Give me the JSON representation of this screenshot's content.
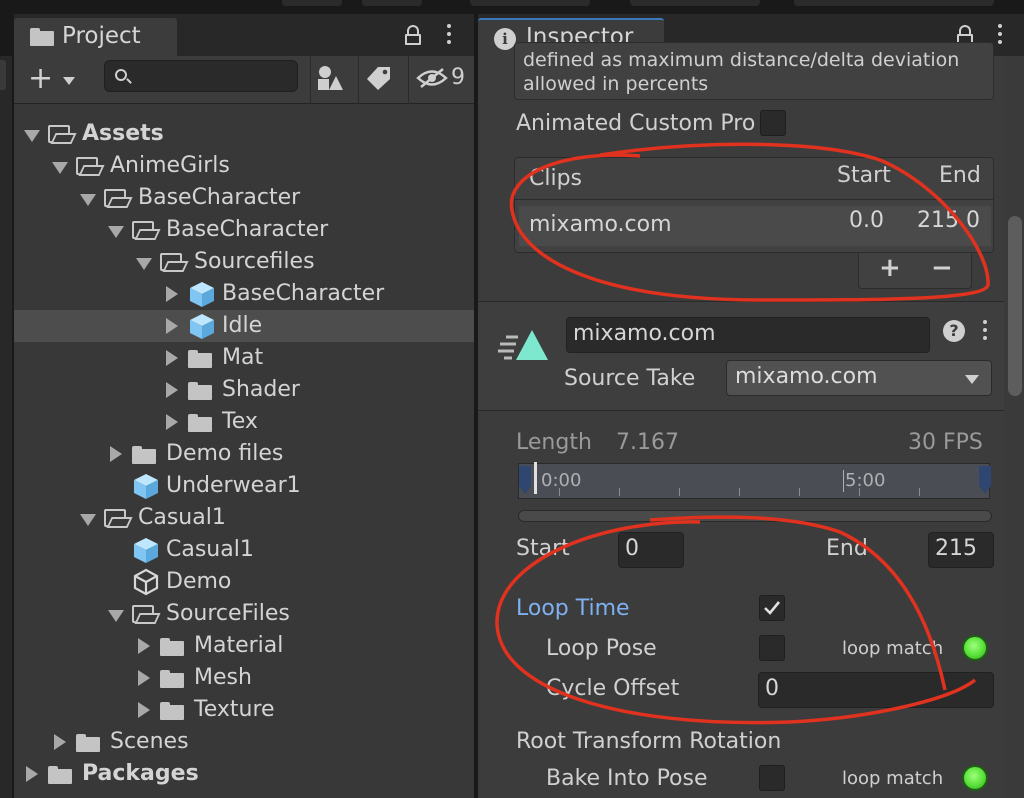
{
  "project": {
    "tab_label": "Project",
    "search": {
      "value": "",
      "placeholder": ""
    },
    "hidden_count": "9",
    "tree": [
      {
        "label": "Assets",
        "bold": true,
        "depth": 0,
        "expanded": true,
        "kind": "folder"
      },
      {
        "label": "AnimeGirls",
        "depth": 1,
        "expanded": true,
        "kind": "folder"
      },
      {
        "label": "BaseCharacter",
        "depth": 2,
        "expanded": true,
        "kind": "folder"
      },
      {
        "label": "BaseCharacter",
        "depth": 3,
        "expanded": true,
        "kind": "folder"
      },
      {
        "label": "Sourcefiles",
        "depth": 4,
        "expanded": true,
        "kind": "folder"
      },
      {
        "label": "BaseCharacter",
        "depth": 5,
        "expanded": false,
        "kind": "prefab"
      },
      {
        "label": "Idle",
        "depth": 5,
        "expanded": false,
        "kind": "prefab",
        "selected": true
      },
      {
        "label": "Mat",
        "depth": 5,
        "expanded": false,
        "kind": "folder"
      },
      {
        "label": "Shader",
        "depth": 5,
        "expanded": false,
        "kind": "folder"
      },
      {
        "label": "Tex",
        "depth": 5,
        "expanded": false,
        "kind": "folder"
      },
      {
        "label": "Demo files",
        "depth": 3,
        "expanded": false,
        "kind": "folder"
      },
      {
        "label": "Underwear1",
        "depth": 3,
        "kind": "prefab"
      },
      {
        "label": "Casual1",
        "depth": 2,
        "expanded": true,
        "kind": "folder"
      },
      {
        "label": "Casual1",
        "depth": 3,
        "kind": "prefab"
      },
      {
        "label": "Demo",
        "depth": 3,
        "kind": "unity"
      },
      {
        "label": "SourceFiles",
        "depth": 3,
        "expanded": true,
        "kind": "folder"
      },
      {
        "label": "Material",
        "depth": 4,
        "expanded": false,
        "kind": "folder"
      },
      {
        "label": "Mesh",
        "depth": 4,
        "expanded": false,
        "kind": "folder"
      },
      {
        "label": "Texture",
        "depth": 4,
        "expanded": false,
        "kind": "folder"
      },
      {
        "label": "Scenes",
        "depth": 1,
        "expanded": false,
        "kind": "folder"
      },
      {
        "label": "Packages",
        "bold": true,
        "depth": 0,
        "expanded": false,
        "kind": "folder"
      }
    ]
  },
  "inspector": {
    "tab_label": "Inspector",
    "help_text_line1": "defined as maximum distance/delta deviation",
    "help_text_line2": "allowed in percents",
    "animated_custom_label": "Animated Custom Pro",
    "clips": {
      "header_clips": "Clips",
      "header_start": "Start",
      "header_end": "End",
      "rows": [
        {
          "name": "mixamo.com",
          "start": "0.0",
          "end": "215.0"
        }
      ],
      "add_label": "+",
      "remove_label": "−"
    },
    "clip_name_value": "mixamo.com",
    "help_icon": "?",
    "source_take_label": "Source Take",
    "source_take_value": "mixamo.com",
    "length_label": "Length",
    "length_value": "7.167",
    "fps_label": "30 FPS",
    "timeline_start": "0:00",
    "timeline_mid": "5:00",
    "start_label": "Start",
    "start_value": "0",
    "end_label": "End",
    "end_value": "215",
    "loop_time_label": "Loop Time",
    "loop_time_checked": true,
    "loop_pose_label": "Loop Pose",
    "loop_match_label": "loop match",
    "cycle_offset_label": "Cycle Offset",
    "cycle_offset_value": "0",
    "root_rotation_label": "Root Transform Rotation",
    "bake_into_pose_label": "Bake Into Pose",
    "loop_match_label_2": "loop match"
  },
  "colors": {
    "accent_blue": "#7fb0f0",
    "annotation_red": "#e0321e",
    "loop_match_green": "#58e03a",
    "clip_icon": "#7ee8cf"
  }
}
